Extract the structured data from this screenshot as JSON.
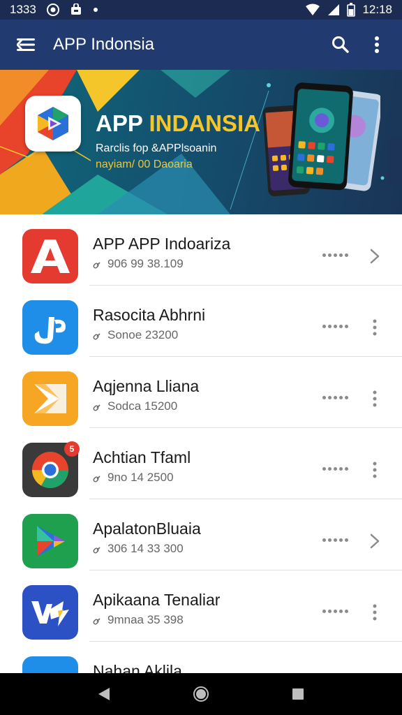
{
  "status_bar": {
    "time_left": "1333",
    "time_right": "12:18",
    "icons": [
      "whatsapp-icon",
      "shop-icon",
      "notification-dot-icon",
      "wifi-icon",
      "signal-icon",
      "battery-icon"
    ]
  },
  "app_bar": {
    "title": "APP Indonsia",
    "icons": [
      "menu-icon",
      "search-icon",
      "more-vert-icon"
    ]
  },
  "banner": {
    "title_word1": "APP",
    "title_word2": "INDANSIA",
    "subtitle_line1": "Rarclis fop &APPlsoanin",
    "subtitle_line2": "nayiam/ 00 Daoaria",
    "colors": {
      "title_accent": "#f5c62a",
      "background": "#14506f"
    }
  },
  "apps": [
    {
      "title": "APP  APP Indoariza",
      "subtitle": "906 99 38.109",
      "action": "chevron-right",
      "icon": "a-logo-icon",
      "color": "#e43a2f"
    },
    {
      "title": "Rasocita Abhrni",
      "subtitle": "Sonoe 23200",
      "action": "more-vert",
      "icon": "jp-logo-icon",
      "color": "#1e8ee8"
    },
    {
      "title": "Aqjenna Lliana",
      "subtitle": "Sodca 15200",
      "action": "more-vert",
      "icon": "play-tile-icon",
      "color": "#f6a623"
    },
    {
      "title": "Achtian Tfaml",
      "subtitle": "9no 14 2500",
      "action": "more-vert",
      "icon": "chrome-like-icon",
      "color": "#3a3a3a",
      "badge": "5"
    },
    {
      "title": "ApalatonBluaia",
      "subtitle": "306 14 33 300",
      "action": "chevron-right",
      "icon": "play-store-icon",
      "color": "#1fa04e"
    },
    {
      "title": "Apikaana Tenaliar",
      "subtitle": "9mnaa 35 398",
      "action": "more-vert",
      "icon": "wp-logo-icon",
      "color": "#2b51c4"
    },
    {
      "title": "Nahan Aklila",
      "subtitle": "",
      "action": "more-vert",
      "icon": "partial-app-icon",
      "color": "#1e8ee8"
    }
  ],
  "nav_bar": {
    "icons": [
      "back-icon",
      "home-icon",
      "recents-icon"
    ]
  }
}
